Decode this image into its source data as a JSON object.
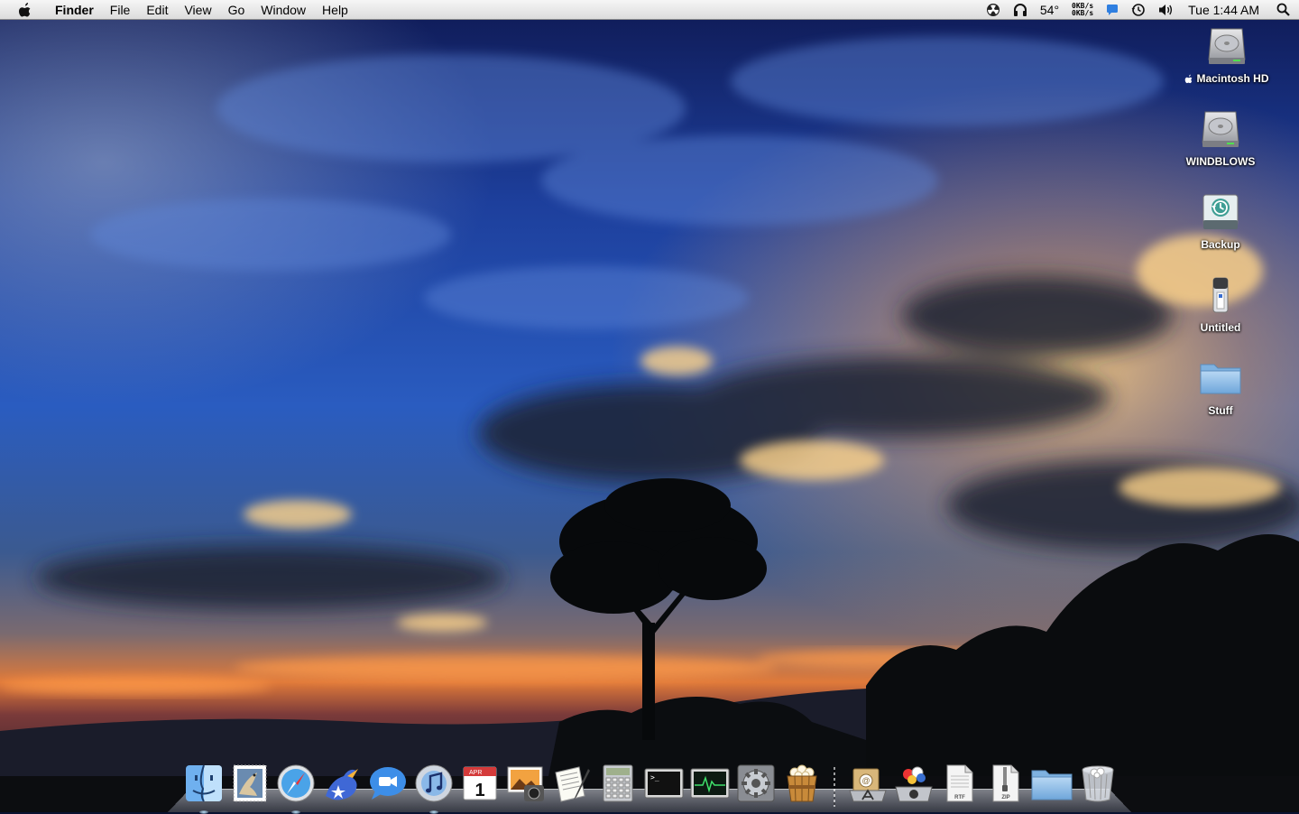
{
  "menubar": {
    "app_name": "Finder",
    "menus": [
      "File",
      "Edit",
      "View",
      "Go",
      "Window",
      "Help"
    ],
    "status": {
      "temperature": "54°",
      "net_up": "0KB/s",
      "net_down": "0KB/s",
      "clock": "Tue 1:44 AM"
    },
    "status_icons": [
      "radiation-icon",
      "headphones-icon",
      "chat-bubble-icon",
      "time-machine-icon",
      "volume-icon",
      "spotlight-icon"
    ]
  },
  "desktop": {
    "icons": [
      {
        "label": "Macintosh HD",
        "icon": "hard-drive-icon"
      },
      {
        "label": "WINDBLOWS",
        "icon": "hard-drive-icon"
      },
      {
        "label": "Backup",
        "icon": "time-machine-drive-icon"
      },
      {
        "label": "Untitled",
        "icon": "usb-drive-icon"
      },
      {
        "label": "Stuff",
        "icon": "folder-icon"
      }
    ]
  },
  "dock": {
    "apps": [
      {
        "name": "Finder",
        "icon": "finder-icon",
        "running": true
      },
      {
        "name": "Mail",
        "icon": "mail-stamp-icon",
        "running": false
      },
      {
        "name": "Safari",
        "icon": "safari-compass-icon",
        "running": true
      },
      {
        "name": "Adium",
        "icon": "adium-duck-icon",
        "running": false
      },
      {
        "name": "iChat",
        "icon": "ichat-bubble-icon",
        "running": false
      },
      {
        "name": "iTunes",
        "icon": "itunes-disc-icon",
        "running": true
      },
      {
        "name": "iCal",
        "icon": "ical-calendar-icon",
        "running": false,
        "month": "APR",
        "day": "1"
      },
      {
        "name": "iPhoto",
        "icon": "iphoto-icon",
        "running": false
      },
      {
        "name": "TextEdit",
        "icon": "textedit-pen-icon",
        "running": false
      },
      {
        "name": "Calculator",
        "icon": "calculator-icon",
        "running": false
      },
      {
        "name": "Terminal",
        "icon": "terminal-icon",
        "running": false,
        "prompt": ">_"
      },
      {
        "name": "Activity Monitor",
        "icon": "activity-monitor-icon",
        "running": false
      },
      {
        "name": "System Preferences",
        "icon": "gear-icon",
        "running": false
      },
      {
        "name": "Popcorn",
        "icon": "popcorn-bucket-icon",
        "running": false
      }
    ],
    "docs": [
      {
        "name": "Applications",
        "icon": "applications-stack-icon"
      },
      {
        "name": "Front Row",
        "icon": "front-row-icon"
      },
      {
        "name": "RTF file",
        "icon": "rtf-document-icon",
        "tag": "RTF"
      },
      {
        "name": "ZIP file",
        "icon": "zip-document-icon",
        "tag": "ZIP"
      },
      {
        "name": "Folder",
        "icon": "folder-icon"
      },
      {
        "name": "Trash",
        "icon": "trash-icon"
      }
    ]
  },
  "colors": {
    "sky_top": "#1a2a78",
    "sky_mid": "#2a5fc0",
    "sunset_orange": "#f08a30",
    "sunset_red": "#c93a2a",
    "menubar_bg": "#e8e8e8"
  }
}
